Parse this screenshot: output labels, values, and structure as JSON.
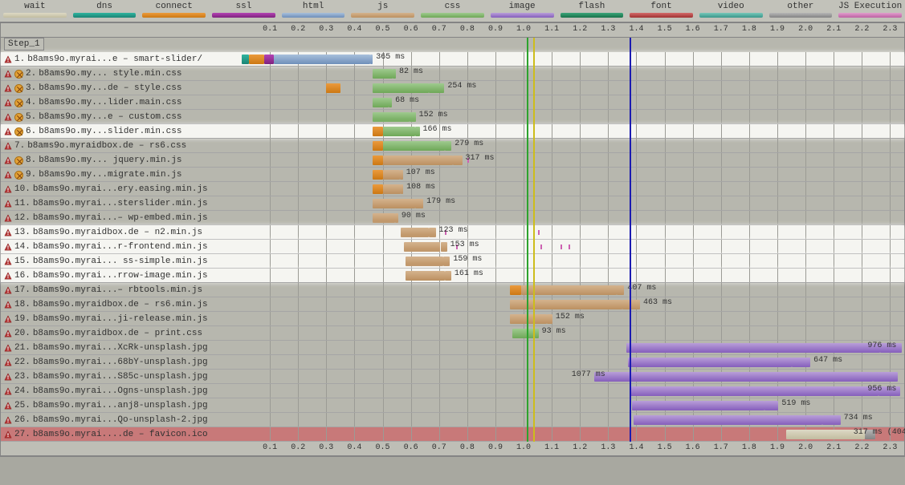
{
  "legend": [
    {
      "label": "wait",
      "cls": "sw-wait"
    },
    {
      "label": "dns",
      "cls": "sw-dns"
    },
    {
      "label": "connect",
      "cls": "sw-connect"
    },
    {
      "label": "ssl",
      "cls": "sw-ssl"
    },
    {
      "label": "html",
      "cls": "sw-html"
    },
    {
      "label": "js",
      "cls": "sw-js"
    },
    {
      "label": "css",
      "cls": "sw-css"
    },
    {
      "label": "image",
      "cls": "sw-image"
    },
    {
      "label": "flash",
      "cls": "sw-flash"
    },
    {
      "label": "font",
      "cls": "sw-font"
    },
    {
      "label": "video",
      "cls": "sw-video"
    },
    {
      "label": "other",
      "cls": "sw-other"
    },
    {
      "label": "JS Execution",
      "cls": "sw-jsexec"
    }
  ],
  "step_label": "Step_1",
  "timeline": {
    "start": 0.0,
    "end": 2.35,
    "tick": 0.1
  },
  "vlines": [
    {
      "t": 1.01,
      "cls": "vl-green"
    },
    {
      "t": 1.035,
      "cls": "vl-yellow"
    },
    {
      "t": 1.375,
      "cls": "vl-blue"
    }
  ],
  "rows": [
    {
      "n": 1,
      "name": "b8ams9o.myrai...e – smart-slider/",
      "warn": true,
      "o": false,
      "hl": true,
      "dur": "365 ms",
      "segs": [
        {
          "t": 0.0,
          "w": 0.025,
          "c": "sw-dns"
        },
        {
          "t": 0.025,
          "w": 0.055,
          "c": "sw-connect"
        },
        {
          "t": 0.08,
          "w": 0.035,
          "c": "sw-ssl"
        },
        {
          "t": 0.115,
          "w": 0.34,
          "c": "sw-html"
        },
        {
          "t": 0.455,
          "w": 0.01,
          "c": "sw-html"
        }
      ],
      "end": 0.465
    },
    {
      "n": 2,
      "name": "b8ams9o.my... style.min.css",
      "warn": true,
      "o": true,
      "dur": "82 ms",
      "segs": [
        {
          "t": 0.465,
          "w": 0.07,
          "c": "sw-css"
        },
        {
          "t": 0.535,
          "w": 0.012,
          "c": "sw-css"
        }
      ],
      "end": 0.547
    },
    {
      "n": 3,
      "name": "b8ams9o.my...de – style.css",
      "warn": true,
      "o": true,
      "dur": "254 ms",
      "segs": [
        {
          "t": 0.3,
          "w": 0.05,
          "c": "sw-connect"
        },
        {
          "t": 0.465,
          "w": 0.2,
          "c": "sw-css"
        },
        {
          "t": 0.665,
          "w": 0.054,
          "c": "sw-css"
        }
      ],
      "end": 0.719
    },
    {
      "n": 4,
      "name": "b8ams9o.my...lider.main.css",
      "warn": true,
      "o": true,
      "dur": "68 ms",
      "segs": [
        {
          "t": 0.465,
          "w": 0.055,
          "c": "sw-css"
        },
        {
          "t": 0.52,
          "w": 0.013,
          "c": "sw-css"
        }
      ],
      "end": 0.533
    },
    {
      "n": 5,
      "name": "b8ams9o.my...e – custom.css",
      "warn": true,
      "o": true,
      "dur": "152 ms",
      "segs": [
        {
          "t": 0.465,
          "w": 0.13,
          "c": "sw-css"
        },
        {
          "t": 0.595,
          "w": 0.022,
          "c": "sw-css"
        }
      ],
      "end": 0.617
    },
    {
      "n": 6,
      "name": "b8ams9o.my...slider.min.css",
      "warn": true,
      "o": true,
      "hl": true,
      "dur": "166 ms",
      "segs": [
        {
          "t": 0.465,
          "w": 0.035,
          "c": "sw-connect"
        },
        {
          "t": 0.5,
          "w": 0.115,
          "c": "sw-css"
        },
        {
          "t": 0.615,
          "w": 0.016,
          "c": "sw-css"
        }
      ],
      "end": 0.631
    },
    {
      "n": 7,
      "name": "b8ams9o.myraidbox.de – rs6.css",
      "warn": true,
      "dur": "279 ms",
      "segs": [
        {
          "t": 0.465,
          "w": 0.035,
          "c": "sw-connect"
        },
        {
          "t": 0.5,
          "w": 0.22,
          "c": "sw-css"
        },
        {
          "t": 0.72,
          "w": 0.024,
          "c": "sw-css"
        }
      ],
      "end": 0.744
    },
    {
      "n": 8,
      "name": "b8ams9o.my... jquery.min.js",
      "warn": true,
      "o": true,
      "dur": "317 ms",
      "segs": [
        {
          "t": 0.465,
          "w": 0.035,
          "c": "sw-connect"
        },
        {
          "t": 0.5,
          "w": 0.25,
          "c": "sw-js"
        },
        {
          "t": 0.75,
          "w": 0.032,
          "c": "sw-js"
        }
      ],
      "end": 0.782,
      "marks": [
        {
          "t": 0.8
        }
      ]
    },
    {
      "n": 9,
      "name": "b8ams9o.my...migrate.min.js",
      "warn": true,
      "o": true,
      "dur": "107 ms",
      "segs": [
        {
          "t": 0.465,
          "w": 0.035,
          "c": "sw-connect"
        },
        {
          "t": 0.5,
          "w": 0.062,
          "c": "sw-js"
        },
        {
          "t": 0.562,
          "w": 0.01,
          "c": "sw-js"
        }
      ],
      "end": 0.572
    },
    {
      "n": 10,
      "name": "b8ams9o.myrai...ery.easing.min.js",
      "warn": true,
      "dur": "108 ms",
      "segs": [
        {
          "t": 0.465,
          "w": 0.035,
          "c": "sw-connect"
        },
        {
          "t": 0.5,
          "w": 0.063,
          "c": "sw-js"
        },
        {
          "t": 0.563,
          "w": 0.01,
          "c": "sw-js"
        }
      ],
      "end": 0.573
    },
    {
      "n": 11,
      "name": "b8ams9o.myrai...sterslider.min.js",
      "warn": true,
      "dur": "179 ms",
      "segs": [
        {
          "t": 0.465,
          "w": 0.15,
          "c": "sw-js"
        },
        {
          "t": 0.615,
          "w": 0.029,
          "c": "sw-js"
        }
      ],
      "end": 0.644
    },
    {
      "n": 12,
      "name": "b8ams9o.myrai...– wp-embed.min.js",
      "warn": true,
      "dur": "90 ms",
      "segs": [
        {
          "t": 0.465,
          "w": 0.08,
          "c": "sw-js"
        },
        {
          "t": 0.545,
          "w": 0.01,
          "c": "sw-js"
        }
      ],
      "end": 0.555
    },
    {
      "n": 13,
      "name": "b8ams9o.myraidbox.de – n2.min.js",
      "warn": true,
      "hl": true,
      "dur": "123 ms",
      "segs": [
        {
          "t": 0.565,
          "w": 0.1,
          "c": "sw-js"
        },
        {
          "t": 0.665,
          "w": 0.023,
          "c": "sw-js"
        }
      ],
      "end": 0.688,
      "marks": [
        {
          "t": 0.72
        },
        {
          "t": 1.05
        }
      ]
    },
    {
      "n": 14,
      "name": "b8ams9o.myrai...r-frontend.min.js",
      "warn": true,
      "hl": true,
      "dur": "153 ms",
      "segs": [
        {
          "t": 0.575,
          "w": 0.13,
          "c": "sw-js"
        },
        {
          "t": 0.705,
          "w": 0.023,
          "c": "sw-js"
        }
      ],
      "end": 0.728,
      "marks": [
        {
          "t": 0.76
        },
        {
          "t": 1.06
        },
        {
          "t": 1.13
        },
        {
          "t": 1.16
        }
      ]
    },
    {
      "n": 15,
      "name": "b8ams9o.myrai... ss-simple.min.js",
      "warn": true,
      "hl": true,
      "dur": "159 ms",
      "segs": [
        {
          "t": 0.58,
          "w": 0.135,
          "c": "sw-js"
        },
        {
          "t": 0.715,
          "w": 0.024,
          "c": "sw-js"
        }
      ],
      "end": 0.739
    },
    {
      "n": 16,
      "name": "b8ams9o.myrai...rrow-image.min.js",
      "warn": true,
      "hl": true,
      "dur": "161 ms",
      "segs": [
        {
          "t": 0.582,
          "w": 0.138,
          "c": "sw-js"
        },
        {
          "t": 0.72,
          "w": 0.023,
          "c": "sw-js"
        }
      ],
      "end": 0.743
    },
    {
      "n": 17,
      "name": "b8ams9o.myrai...– rbtools.min.js",
      "warn": true,
      "dur": "407 ms",
      "segs": [
        {
          "t": 0.95,
          "w": 0.04,
          "c": "sw-connect"
        },
        {
          "t": 0.99,
          "w": 0.34,
          "c": "sw-js"
        },
        {
          "t": 1.33,
          "w": 0.027,
          "c": "sw-js"
        }
      ],
      "end": 1.357
    },
    {
      "n": 18,
      "name": "b8ams9o.myraidbox.de – rs6.min.js",
      "warn": true,
      "dur": "463 ms",
      "segs": [
        {
          "t": 0.95,
          "w": 0.4,
          "c": "sw-js"
        },
        {
          "t": 1.35,
          "w": 0.063,
          "c": "sw-js"
        }
      ],
      "end": 1.413
    },
    {
      "n": 19,
      "name": "b8ams9o.myrai...ji-release.min.js",
      "warn": true,
      "dur": "152 ms",
      "segs": [
        {
          "t": 0.95,
          "w": 0.132,
          "c": "sw-js"
        },
        {
          "t": 1.082,
          "w": 0.02,
          "c": "sw-js"
        }
      ],
      "end": 1.102
    },
    {
      "n": 20,
      "name": "b8ams9o.myraidbox.de – print.css",
      "warn": true,
      "dur": "93 ms",
      "segs": [
        {
          "t": 0.96,
          "w": 0.08,
          "c": "sw-css"
        },
        {
          "t": 1.04,
          "w": 0.013,
          "c": "sw-css"
        }
      ],
      "end": 1.053
    },
    {
      "n": 21,
      "name": "b8ams9o.myrai...XcRk-unsplash.jpg",
      "warn": true,
      "dur": "976 ms",
      "segs": [
        {
          "t": 1.365,
          "w": 0.9,
          "c": "sw-image"
        },
        {
          "t": 2.265,
          "w": 0.076,
          "c": "sw-image"
        }
      ],
      "end": 2.341,
      "durpos": 2.22
    },
    {
      "n": 22,
      "name": "b8ams9o.myrai...68bY-unsplash.jpg",
      "warn": true,
      "dur": "647 ms",
      "segs": [
        {
          "t": 1.37,
          "w": 0.58,
          "c": "sw-image"
        },
        {
          "t": 1.95,
          "w": 0.067,
          "c": "sw-image"
        }
      ],
      "end": 2.017
    },
    {
      "n": 23,
      "name": "b8ams9o.myrai...S85c-unsplash.jpg",
      "warn": true,
      "dur": "1077 ms",
      "segs": [
        {
          "t": 1.25,
          "w": 0.99,
          "c": "sw-image"
        },
        {
          "t": 2.24,
          "w": 0.087,
          "c": "sw-image"
        }
      ],
      "end": 2.327,
      "durpos": 1.17
    },
    {
      "n": 24,
      "name": "b8ams9o.myrai...Ogns-unsplash.jpg",
      "warn": true,
      "dur": "956 ms",
      "segs": [
        {
          "t": 1.38,
          "w": 0.88,
          "c": "sw-image"
        },
        {
          "t": 2.26,
          "w": 0.076,
          "c": "sw-image"
        }
      ],
      "end": 2.336,
      "durpos": 2.22
    },
    {
      "n": 25,
      "name": "b8ams9o.myrai...anj8-unsplash.jpg",
      "warn": true,
      "dur": "519 ms",
      "segs": [
        {
          "t": 1.385,
          "w": 0.47,
          "c": "sw-image"
        },
        {
          "t": 1.855,
          "w": 0.049,
          "c": "sw-image"
        }
      ],
      "end": 1.904
    },
    {
      "n": 26,
      "name": "b8ams9o.myrai...Qo-unsplash-2.jpg",
      "warn": true,
      "dur": "734 ms",
      "segs": [
        {
          "t": 1.39,
          "w": 0.67,
          "c": "sw-image"
        },
        {
          "t": 2.06,
          "w": 0.064,
          "c": "sw-image"
        }
      ],
      "end": 2.124
    },
    {
      "n": 27,
      "name": "b8ams9o.myrai....de – favicon.ico",
      "warn": true,
      "err": true,
      "dur": "317 ms (404)",
      "segs": [
        {
          "t": 1.93,
          "w": 0.28,
          "c": "sw-wait"
        },
        {
          "t": 2.21,
          "w": 0.037,
          "c": "sw-other"
        }
      ],
      "end": 2.247,
      "durpos": 2.17
    }
  ]
}
